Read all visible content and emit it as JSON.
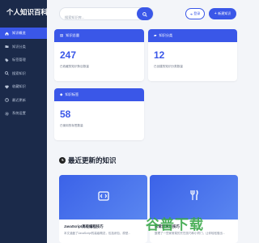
{
  "brand": {
    "title": "个人知识百科"
  },
  "sidebar": {
    "items": [
      {
        "label": "知识概览",
        "icon": "home-icon"
      },
      {
        "label": "知识分类",
        "icon": "folder-icon"
      },
      {
        "label": "标签管理",
        "icon": "tag-icon"
      },
      {
        "label": "搜索知识",
        "icon": "search-icon"
      },
      {
        "label": "收藏知识",
        "icon": "heart-icon"
      },
      {
        "label": "最近更新",
        "icon": "clock-icon"
      },
      {
        "label": "系统设置",
        "icon": "gear-icon"
      }
    ],
    "active_index": 0
  },
  "search": {
    "placeholder": "搜索知识库..."
  },
  "header": {
    "login_label": "登录",
    "add_label": "新建知识"
  },
  "stats": [
    {
      "title": "知识总量",
      "value": "247",
      "desc": "已收藏的知识条目数量"
    },
    {
      "title": "知识分类",
      "value": "12",
      "desc": "已创建的知识分类数量"
    },
    {
      "title": "知识标签",
      "value": "58",
      "desc": "已使用的标签数量"
    }
  ],
  "recent": {
    "title": "最近更新的知识",
    "items": [
      {
        "title": "JavaScript高级编程技巧",
        "desc": "本文涵盖了JavaScript的高级概念，包括闭包、原型...",
        "icon": "code-icon"
      },
      {
        "title": "家常菜烹饪技巧",
        "desc": "整理了一些家常菜的烹饪技巧和小窍门，让你轻松做出...",
        "icon": "utensils-icon"
      }
    ]
  },
  "watermark": {
    "text": "谷普下载"
  },
  "colors": {
    "accent": "#3a57e8",
    "sidebar": "#1b2a4a",
    "background": "#f3f5f9"
  }
}
